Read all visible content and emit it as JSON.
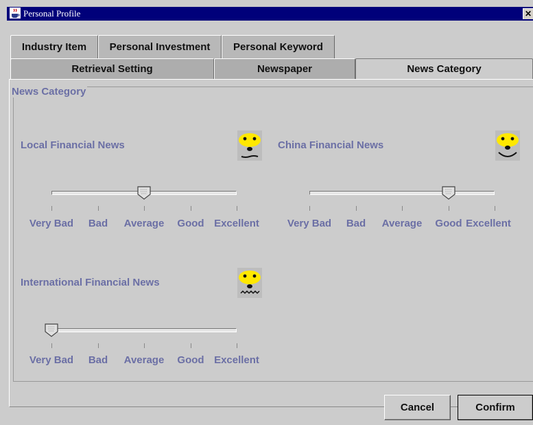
{
  "window": {
    "title": "Personal Profile",
    "close_glyph": "✕"
  },
  "tabs_row1": [
    {
      "label": "Industry Item"
    },
    {
      "label": "Personal Investment"
    },
    {
      "label": "Personal Keyword"
    }
  ],
  "tabs_row2": [
    {
      "label": "Retrieval Setting"
    },
    {
      "label": "Newspaper"
    },
    {
      "label": "News Category",
      "active": true
    }
  ],
  "group_title": "News Category",
  "scale_labels": [
    "Very Bad",
    "Bad",
    "Average",
    "Good",
    "Excellent"
  ],
  "sliders": [
    {
      "label": "Local Financial News",
      "value": "Average",
      "level": 0.5,
      "face": "neutral-face-icon"
    },
    {
      "label": "China Financial News",
      "value": "Good",
      "level": 0.75,
      "face": "smile-face-icon"
    },
    {
      "label": "International Financial News",
      "value": "Very Bad",
      "level": 0.0,
      "face": "worried-face-icon"
    }
  ],
  "buttons": {
    "cancel": "Cancel",
    "confirm": "Confirm"
  },
  "colors": {
    "titlebar": "#00007a",
    "label": "#6b6fa5",
    "background": "#cccccc",
    "face": "#ffe800"
  }
}
